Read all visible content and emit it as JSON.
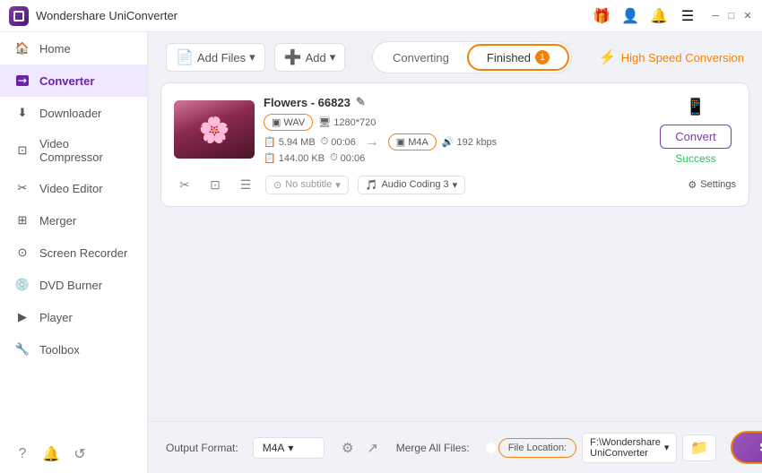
{
  "titlebar": {
    "app_name": "Wondershare UniConverter",
    "icons": [
      "gift",
      "user",
      "bell",
      "menu",
      "minimize",
      "maximize",
      "close"
    ]
  },
  "sidebar": {
    "items": [
      {
        "id": "home",
        "label": "Home",
        "icon": "🏠",
        "active": false
      },
      {
        "id": "converter",
        "label": "Converter",
        "icon": "⇄",
        "active": true
      },
      {
        "id": "downloader",
        "label": "Downloader",
        "icon": "⬇",
        "active": false
      },
      {
        "id": "video-compressor",
        "label": "Video Compressor",
        "icon": "⊡",
        "active": false
      },
      {
        "id": "video-editor",
        "label": "Video Editor",
        "icon": "✂",
        "active": false
      },
      {
        "id": "merger",
        "label": "Merger",
        "icon": "⊞",
        "active": false
      },
      {
        "id": "screen-recorder",
        "label": "Screen Recorder",
        "icon": "⊙",
        "active": false
      },
      {
        "id": "dvd-burner",
        "label": "DVD Burner",
        "icon": "💿",
        "active": false
      },
      {
        "id": "player",
        "label": "Player",
        "icon": "▶",
        "active": false
      },
      {
        "id": "toolbox",
        "label": "Toolbox",
        "icon": "🔧",
        "active": false
      }
    ],
    "bottom_icons": [
      "?",
      "🔔",
      "↺"
    ]
  },
  "topbar": {
    "add_files_label": "Add Files",
    "add_label": "Add",
    "tabs": [
      {
        "id": "converting",
        "label": "Converting",
        "badge": null
      },
      {
        "id": "finished",
        "label": "Finished",
        "badge": "1"
      }
    ],
    "active_tab": "finished",
    "high_speed_label": "High Speed Conversion"
  },
  "file_card": {
    "file_name": "Flowers - 66823",
    "input_format": "WAV",
    "input_resolution": "1280*720",
    "input_size": "5.94 MB",
    "input_duration": "00:06",
    "output_format": "M4A",
    "output_bitrate": "192 kbps",
    "output_size": "144.00 KB",
    "output_duration": "00:06",
    "subtitle_placeholder": "No subtitle",
    "audio_coding_label": "Audio Coding 3",
    "settings_label": "Settings",
    "convert_button_label": "Convert",
    "success_label": "Success"
  },
  "bottom_bar": {
    "output_format_label": "Output Format:",
    "output_format_value": "M4A",
    "merge_label": "Merge All Files:",
    "file_location_label": "File Location:",
    "file_location_path": "F:\\Wondershare UniConverter",
    "start_all_label": "Start All"
  }
}
